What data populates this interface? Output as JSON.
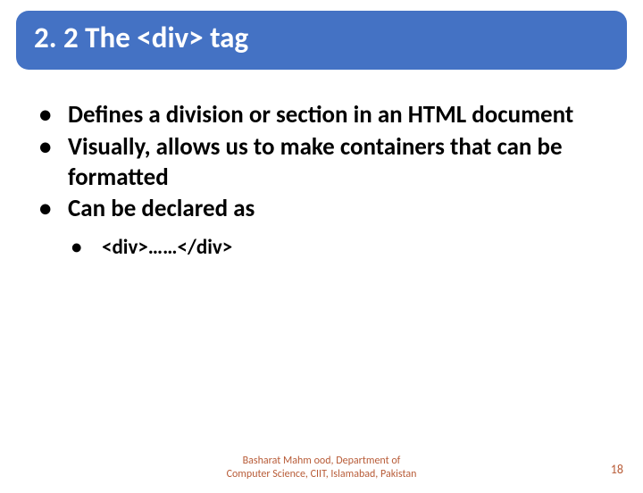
{
  "title": "2. 2 The <div> tag",
  "bullets": [
    {
      "pre": "Defines a ",
      "bold": "division or section",
      "post": " in an HTML document"
    },
    {
      "pre": "Visually, allows us to make ",
      "bold": "containers",
      "post": " that can be formatted"
    },
    {
      "pre": "Can be declared as",
      "bold": "",
      "post": ""
    }
  ],
  "sub_bullet": "<div>……</div>",
  "footer_line1": "Basharat Mahm ood, Department of",
  "footer_line2": "Computer Science, CIIT, Islamabad, Pakistan",
  "page_number": "18"
}
